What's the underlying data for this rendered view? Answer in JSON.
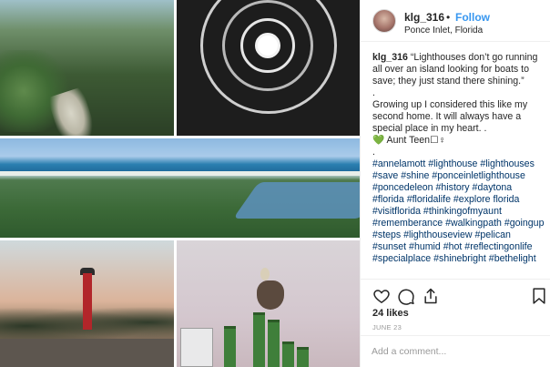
{
  "post": {
    "username": "klg_316",
    "separator": "•",
    "follow_label": "Follow",
    "location": "Ponce Inlet, Florida",
    "caption": {
      "username": "klg_316",
      "quote": "“Lighthouses don’t go running all over an island looking for boats to save; they just stand there shining.”",
      "dot1": ".",
      "body": "Growing up I considered this like my second home. It will always have a special place in my heart. .",
      "sign_heart": "💚",
      "sign_text": " Aunt Teen☐♀",
      "dot2": ".",
      "hashtags": "#annelamott #lighthouse #lighthouses #save #shine #ponceinletlighthouse #poncedeleon #history #daytona #florida #floridalife #explore florida #visitflorida #thinkingofmyaunt #rememberance #walkingpath #goingup #steps #lighthouseview #pelican #sunset #humid #hot #reflectingonlife #specialplace #shinebright #bethelight"
    },
    "likes": "24 likes",
    "date": "JUNE 23",
    "comment_placeholder": "Add a comment..."
  },
  "icons": {
    "like": "heart-icon",
    "comment": "comment-icon",
    "share": "share-icon",
    "save": "bookmark-icon"
  },
  "colors": {
    "follow": "#3897f0",
    "hashtag": "#003569",
    "text": "#262626",
    "muted": "#999999"
  }
}
